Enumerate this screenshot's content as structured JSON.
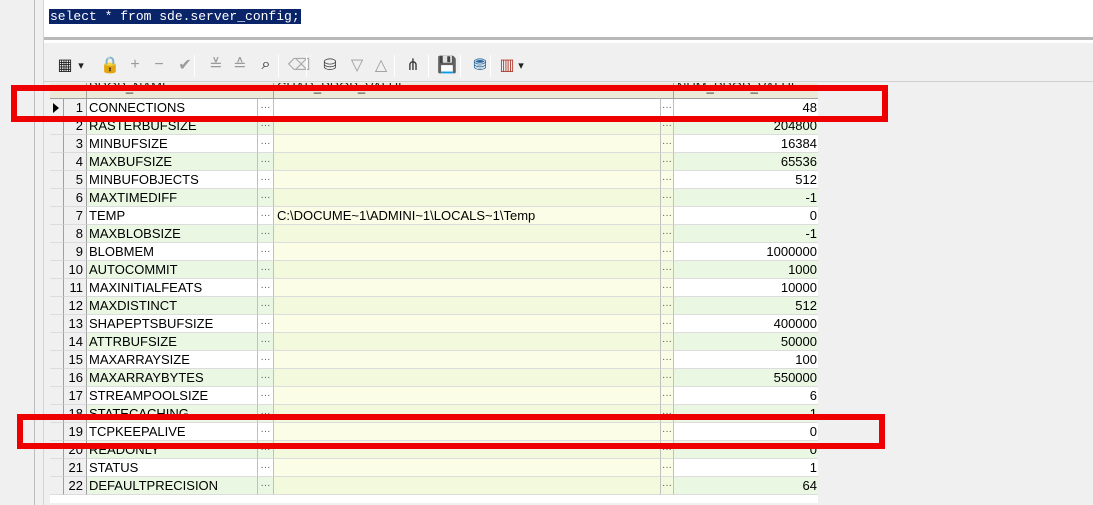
{
  "editor": {
    "sql": "select * from sde.server_config;"
  },
  "toolbar": {
    "buttons": [
      {
        "name": "grid-view-icon",
        "glyph": "▦"
      },
      {
        "name": "dropdown-arrow-icon",
        "glyph": "▾"
      },
      {
        "name": "lock-icon",
        "glyph": "🔒"
      },
      {
        "name": "add-record-icon",
        "glyph": "+"
      },
      {
        "name": "delete-record-icon",
        "glyph": "−"
      },
      {
        "name": "post-edit-icon",
        "glyph": "✔"
      },
      {
        "name": "sort-desc-icon",
        "glyph": "≚"
      },
      {
        "name": "sort-asc-icon",
        "glyph": "≙"
      },
      {
        "name": "find-icon",
        "glyph": "⌕"
      },
      {
        "name": "clear-icon",
        "glyph": "⌫"
      },
      {
        "name": "query-builder-icon",
        "glyph": "⛁"
      },
      {
        "name": "move-down-icon",
        "glyph": "▽"
      },
      {
        "name": "move-up-icon",
        "glyph": "△"
      },
      {
        "name": "tree-view-icon",
        "glyph": "⋔"
      },
      {
        "name": "save-icon",
        "glyph": "💾"
      },
      {
        "name": "database-icon",
        "glyph": "⛃"
      },
      {
        "name": "chart-icon",
        "glyph": "▥"
      },
      {
        "name": "chart-dropdown-icon",
        "glyph": "▾"
      }
    ]
  },
  "grid": {
    "columns": [
      "PROP_NAME",
      "CHAR_PROP_VALUE",
      "NUM_PROP_VALUE"
    ],
    "ellipsis": "···",
    "rows": [
      {
        "n": "1",
        "name": "CONNECTIONS",
        "char": "",
        "num": "48"
      },
      {
        "n": "2",
        "name": "RASTERBUFSIZE",
        "char": "",
        "num": "204800"
      },
      {
        "n": "3",
        "name": "MINBUFSIZE",
        "char": "",
        "num": "16384"
      },
      {
        "n": "4",
        "name": "MAXBUFSIZE",
        "char": "",
        "num": "65536"
      },
      {
        "n": "5",
        "name": "MINBUFOBJECTS",
        "char": "",
        "num": "512"
      },
      {
        "n": "6",
        "name": "MAXTIMEDIFF",
        "char": "",
        "num": "-1"
      },
      {
        "n": "7",
        "name": "TEMP",
        "char": "C:\\DOCUME~1\\ADMINI~1\\LOCALS~1\\Temp",
        "num": "0"
      },
      {
        "n": "8",
        "name": "MAXBLOBSIZE",
        "char": "",
        "num": "-1"
      },
      {
        "n": "9",
        "name": "BLOBMEM",
        "char": "",
        "num": "1000000"
      },
      {
        "n": "10",
        "name": "AUTOCOMMIT",
        "char": "",
        "num": "1000"
      },
      {
        "n": "11",
        "name": "MAXINITIALFEATS",
        "char": "",
        "num": "10000"
      },
      {
        "n": "12",
        "name": "MAXDISTINCT",
        "char": "",
        "num": "512"
      },
      {
        "n": "13",
        "name": "SHAPEPTSBUFSIZE",
        "char": "",
        "num": "400000"
      },
      {
        "n": "14",
        "name": "ATTRBUFSIZE",
        "char": "",
        "num": "50000"
      },
      {
        "n": "15",
        "name": "MAXARRAYSIZE",
        "char": "",
        "num": "100"
      },
      {
        "n": "16",
        "name": "MAXARRAYBYTES",
        "char": "",
        "num": "550000"
      },
      {
        "n": "17",
        "name": "STREAMPOOLSIZE",
        "char": "",
        "num": "6"
      },
      {
        "n": "18",
        "name": "STATECACHING",
        "char": "",
        "num": "1"
      },
      {
        "n": "19",
        "name": "TCPKEEPALIVE",
        "char": "",
        "num": "0"
      },
      {
        "n": "20",
        "name": "READONLY",
        "char": "",
        "num": "0"
      },
      {
        "n": "21",
        "name": "STATUS",
        "char": "",
        "num": "1"
      },
      {
        "n": "22",
        "name": "DEFAULTPRECISION",
        "char": "",
        "num": "64"
      }
    ]
  },
  "colors": {
    "highlight": "#ee0000",
    "selection": "#0a246a",
    "alt_row": "#e9f7e3"
  }
}
